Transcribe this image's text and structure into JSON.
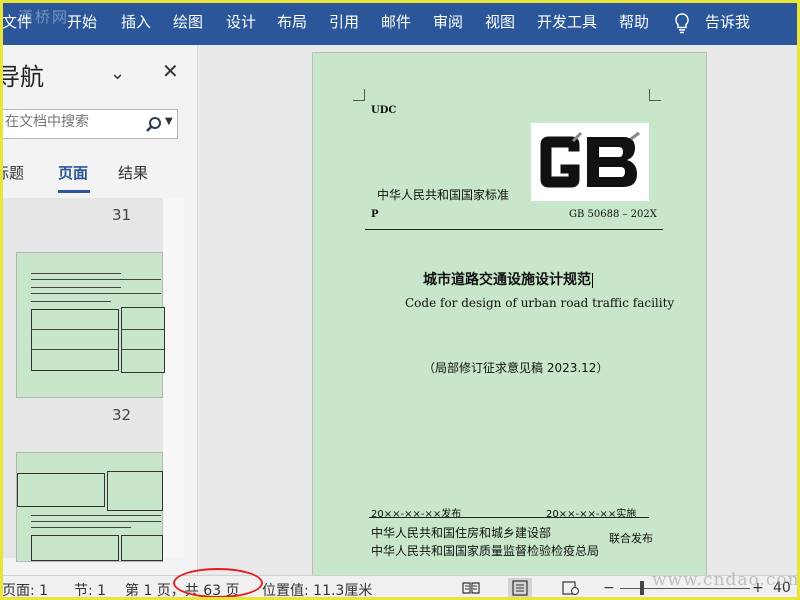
{
  "ribbon": {
    "watermark": "潇桥网",
    "tabs": [
      "文件",
      "开始",
      "插入",
      "绘图",
      "设计",
      "布局",
      "引用",
      "邮件",
      "审阅",
      "视图",
      "开发工具",
      "帮助",
      "告诉我"
    ],
    "background": "#2b579a"
  },
  "nav": {
    "title": "导航",
    "chevron": "⌄",
    "close": "✕",
    "search_placeholder": "在文档中搜索",
    "tabs": [
      "标题",
      "页面",
      "结果"
    ],
    "active_tab": "页面",
    "pages": [
      "31",
      "32"
    ]
  },
  "document": {
    "udc": "UDC",
    "org_std": "中华人民共和国国家标准",
    "p_label": "P",
    "gb_code": "GB 50688 – 202X",
    "title_cn": "城市道路交通设施设计规范",
    "title_en": "Code for design of urban road traffic facility",
    "subtitle": "（局部修订征求意见稿 2023.12）",
    "publish_date": "20××-××-××发布",
    "implement_date": "20××-××-××实施",
    "issuer1": "中华人民共和国住房和城乡建设部",
    "issuer2": "中华人民共和国国家质量监督检验检疫总局",
    "joint": "联合发布",
    "page_color": "#c8e6c9"
  },
  "status": {
    "page": "页面: 1",
    "section": "节: 1",
    "page_of": "第 1 页，共 63 页",
    "position": "位置值: 11.3厘米",
    "zoom": "40",
    "watermark": "www.cndao.com"
  }
}
